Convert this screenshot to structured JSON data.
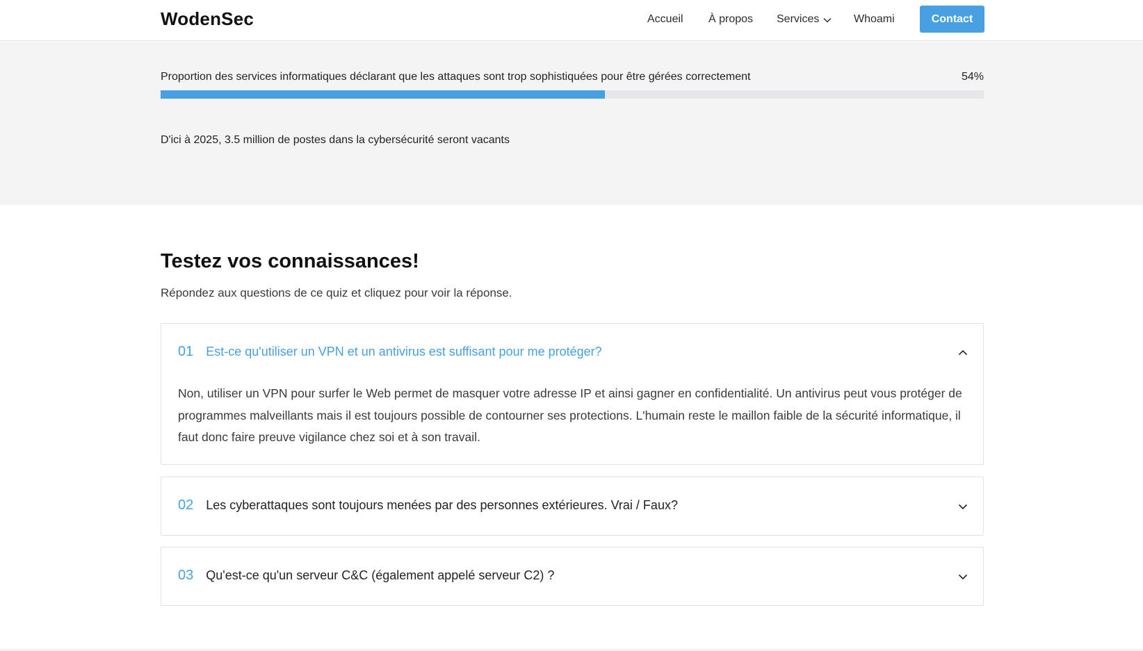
{
  "header": {
    "logo": "WodenSec",
    "nav": {
      "accueil": "Accueil",
      "apropos": "À propos",
      "services": "Services",
      "whoami": "Whoami"
    },
    "contact_label": "Contact"
  },
  "stats": {
    "bar_label": "Proportion des services informatiques déclarant que les attaques sont trop sophistiquées pour être gérées correctement",
    "bar_value_text": "54%",
    "bar_value": 54,
    "fact": "D'ici à 2025, 3.5 million de postes dans la cybersécurité seront vacants"
  },
  "quiz": {
    "title": "Testez vos connaissances!",
    "subtitle": "Répondez aux questions de ce quiz et cliquez pour voir la réponse.",
    "items": [
      {
        "num": "01",
        "question": "Est-ce qu'utiliser un VPN et un antivirus est suffisant pour me protéger?",
        "answer": "Non, utiliser un VPN pour surfer le Web permet de masquer votre adresse IP et ainsi gagner en confidentialité. Un antivirus peut vous protéger de programmes malveillants mais il est toujours possible de contourner ses protections. L'humain reste le maillon faible de la sécurité informatique, il faut donc faire preuve vigilance chez soi et à son travail.",
        "expanded": true
      },
      {
        "num": "02",
        "question": "Les cyberattaques sont toujours menées par des personnes extérieures. Vrai / Faux?",
        "expanded": false
      },
      {
        "num": "03",
        "question": "Qu'est-ce qu'un serveur C&C (également appelé serveur C2) ?",
        "expanded": false
      }
    ]
  },
  "colors": {
    "accent": "#47a0e2",
    "stats_background": "#f4f4f4",
    "progress_track": "#e6e6ea"
  },
  "icons": {
    "services_dropdown": "chevron-down-icon",
    "faq_expanded": "chevron-up-icon",
    "faq_collapsed": "chevron-down-icon"
  }
}
